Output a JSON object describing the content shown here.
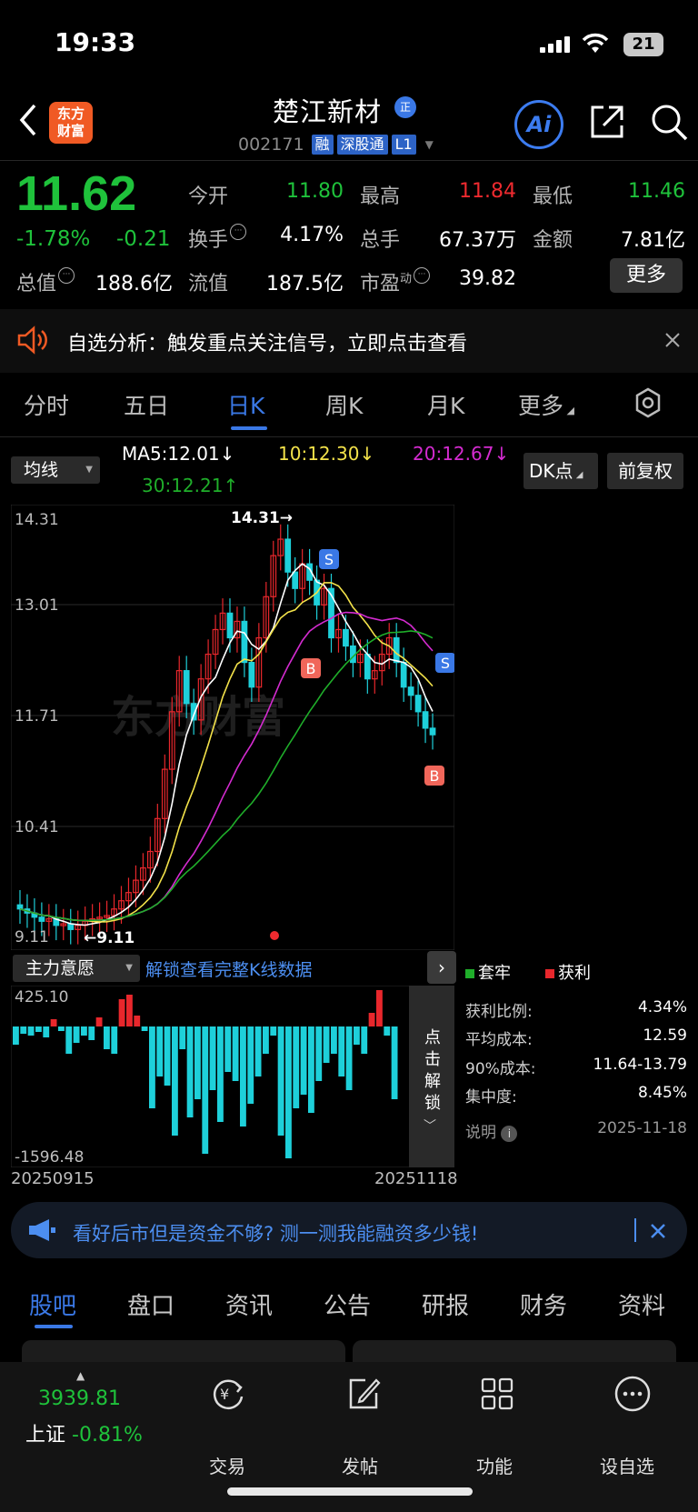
{
  "status_bar": {
    "time": "19:33",
    "battery": "21"
  },
  "header": {
    "logo": "东方财富",
    "stock_name": "楚江新材",
    "name_badge": "正",
    "code": "002171",
    "tags": [
      "融",
      "深股通",
      "L1"
    ]
  },
  "quote": {
    "price": "11.62",
    "change_pct": "-1.78%",
    "change_amt": "-0.21",
    "open_label": "今开",
    "open": "11.80",
    "high_label": "最高",
    "high": "11.84",
    "low_label": "最低",
    "low": "11.46",
    "turnover_label": "换手",
    "turnover": "4.17%",
    "volume_label": "总手",
    "volume": "67.37万",
    "amount_label": "金额",
    "amount": "7.81亿",
    "mktcap_label": "总值",
    "mktcap": "188.6亿",
    "float_label": "流值",
    "float": "187.5亿",
    "pe_label": "市盈",
    "pe_sup": "动",
    "pe": "39.82",
    "more": "更多"
  },
  "alert": {
    "text": "自选分析：触发重点关注信号，立即点击查看"
  },
  "chart_tabs": [
    "分时",
    "五日",
    "日K",
    "周K",
    "月K",
    "更多"
  ],
  "chart_toolbar": {
    "ma_select": "均线",
    "ma5": "MA5:12.01↓",
    "ma10": "10:12.30↓",
    "ma20": "20:12.67↓",
    "ma30": "30:12.21↑",
    "dk": "DK点",
    "fq": "前复权"
  },
  "kline": {
    "y_ticks": [
      "14.31",
      "13.01",
      "11.71",
      "10.41",
      "9.11"
    ],
    "high_label": "14.31→",
    "low_label": "←9.11",
    "watermark": "东方财富",
    "signals": [
      "S",
      "B",
      "S",
      "B"
    ]
  },
  "sub_chart": {
    "select": "主力意愿",
    "unlock": "解锁查看完整K线数据",
    "max": "425.10",
    "min": "-1596.48",
    "date_start": "20250915",
    "date_end": "20251118",
    "unlock_side": "点击解锁"
  },
  "chip": {
    "legend_trap": "套牢",
    "legend_profit": "获利",
    "rows": [
      [
        "获利比例:",
        "4.34%"
      ],
      [
        "平均成本:",
        "12.59"
      ],
      [
        "90%成本:",
        "11.64-13.79"
      ],
      [
        "集中度:",
        "8.45%"
      ]
    ],
    "note_label": "说明",
    "date": "2025-11-18"
  },
  "promo": {
    "text": "看好后市但是资金不够? 测一测我能融资多少钱!"
  },
  "bottom_tabs": [
    "股吧",
    "盘口",
    "资讯",
    "公告",
    "研报",
    "财务",
    "资料"
  ],
  "dock": {
    "index_value": "3939.81",
    "index_name": "上证",
    "index_change": "-0.81%",
    "items": [
      "交易",
      "发帖",
      "功能",
      "设自选"
    ]
  },
  "chart_data": {
    "type": "candlestick",
    "y_range": [
      9.11,
      14.31
    ],
    "ma_legend": {
      "MA5": 12.01,
      "MA10": 12.3,
      "MA20": 12.67,
      "MA30": 12.21
    },
    "colors": {
      "up": "#e8272c",
      "down": "#1ed0da",
      "ma5": "#ffffff",
      "ma10": "#f3e24a",
      "ma20": "#d42bd0",
      "ma30": "#1fae2a"
    }
  }
}
